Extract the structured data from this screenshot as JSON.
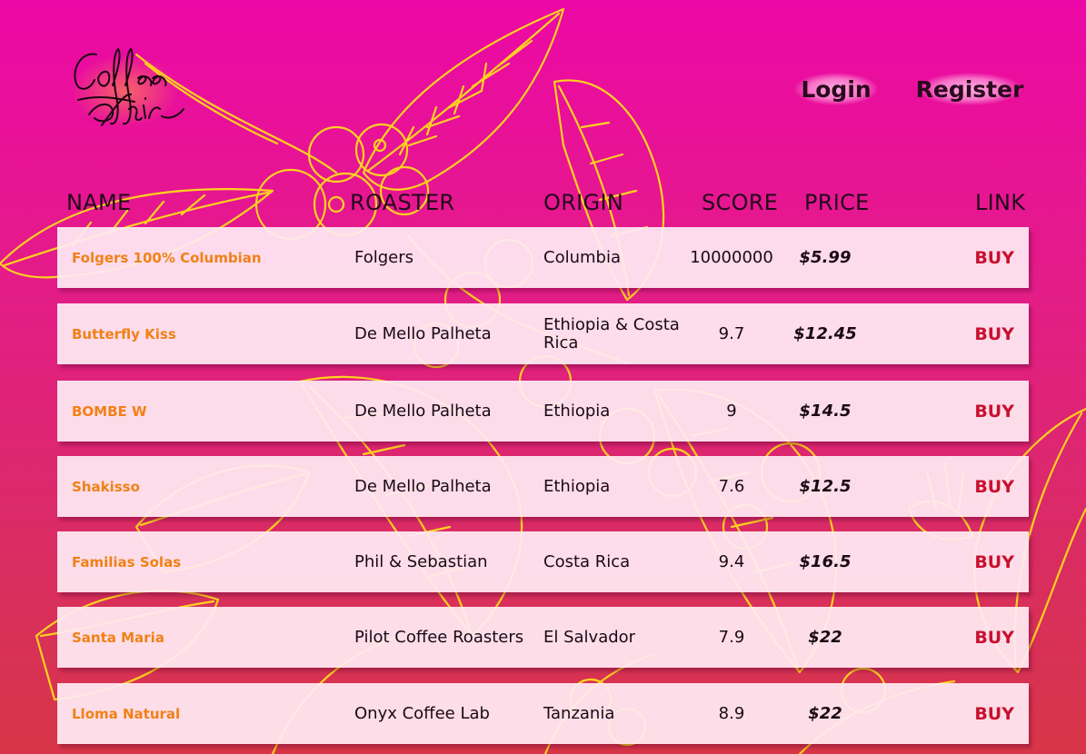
{
  "brand": {
    "logo_text": "Coffee Adict"
  },
  "nav": {
    "login_label": "Login",
    "register_label": "Register"
  },
  "columns": {
    "name": "NAME",
    "roaster": "ROASTER",
    "origin": "ORIGIN",
    "score": "SCORE",
    "price": "PRICE",
    "link": "LINK"
  },
  "rows": [
    {
      "name": "Folgers 100% Columbian",
      "roaster": "Folgers",
      "origin": "Columbia",
      "score": "10000000",
      "price": "$5.99",
      "link": "BUY"
    },
    {
      "name": "Butterfly Kiss",
      "roaster": "De Mello Palheta",
      "origin": "Ethiopia & Costa Rica",
      "score": "9.7",
      "price": "$12.45",
      "link": "BUY"
    },
    {
      "name": "BOMBE W",
      "roaster": "De Mello Palheta",
      "origin": "Ethiopia",
      "score": "9",
      "price": "$14.5",
      "link": "BUY"
    },
    {
      "name": "Shakisso",
      "roaster": "De Mello Palheta",
      "origin": "Ethiopia",
      "score": "7.6",
      "price": "$12.5",
      "link": "BUY"
    },
    {
      "name": "Familias Solas",
      "roaster": "Phil & Sebastian",
      "origin": "Costa Rica",
      "score": "9.4",
      "price": "$16.5",
      "link": "BUY"
    },
    {
      "name": "Santa Maria",
      "roaster": "Pilot Coffee Roasters",
      "origin": "El Salvador",
      "score": "7.9",
      "price": "$22",
      "link": "BUY"
    },
    {
      "name": "Lloma Natural",
      "roaster": "Onyx Coffee Lab",
      "origin": "Tanzania",
      "score": "8.9",
      "price": "$22",
      "link": "BUY"
    }
  ],
  "colors": {
    "background_top": "#ec08a6",
    "background_bottom": "#d83648",
    "line_art": "#ffd21f",
    "name_text": "#f08116",
    "buy_link": "#c8102e",
    "row_bg": "#ffebf3"
  }
}
